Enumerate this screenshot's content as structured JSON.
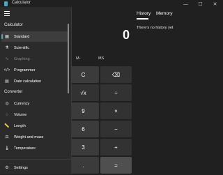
{
  "window": {
    "title": "Calculator",
    "controls": [
      "—",
      "☐",
      "✕"
    ]
  },
  "display": {
    "value": "0"
  },
  "memory": {
    "mminus": "M-",
    "ms": "MS"
  },
  "keys": {
    "c": "C",
    "backspace": "⌫",
    "sqrt": "√x",
    "divide": "÷",
    "nine": "9",
    "multiply": "×",
    "six": "6",
    "minus": "−",
    "three": "3",
    "plus": "+",
    "decimal": ".",
    "equals": "="
  },
  "history": {
    "tab_history": "History",
    "tab_memory": "Memory",
    "empty_message": "There's no history yet"
  },
  "nav": {
    "section_calculator": "Calculator",
    "section_converter": "Converter",
    "items": [
      {
        "label": "Standard",
        "icon": "standard-icon",
        "glyph": "▦"
      },
      {
        "label": "Scientific",
        "icon": "scientific-icon",
        "glyph": "⚗"
      },
      {
        "label": "Graphing",
        "icon": "graphing-icon",
        "glyph": "∿"
      },
      {
        "label": "Programmer",
        "icon": "programmer-icon",
        "glyph": "</>"
      },
      {
        "label": "Date calculation",
        "icon": "date-calculation-icon",
        "glyph": "▤"
      },
      {
        "label": "Currency",
        "icon": "currency-icon",
        "glyph": "◎"
      },
      {
        "label": "Volume",
        "icon": "volume-icon",
        "glyph": "◌"
      },
      {
        "label": "Length",
        "icon": "length-icon",
        "glyph": "📏"
      },
      {
        "label": "Weight and mass",
        "icon": "weight-icon",
        "glyph": "⚖"
      },
      {
        "label": "Temperature",
        "icon": "temperature-icon",
        "glyph": "🌡"
      }
    ],
    "settings": "Settings"
  },
  "colors": {
    "accent": "#5aa3b8",
    "background": "#202020",
    "flyout": "#2b2b2b"
  }
}
